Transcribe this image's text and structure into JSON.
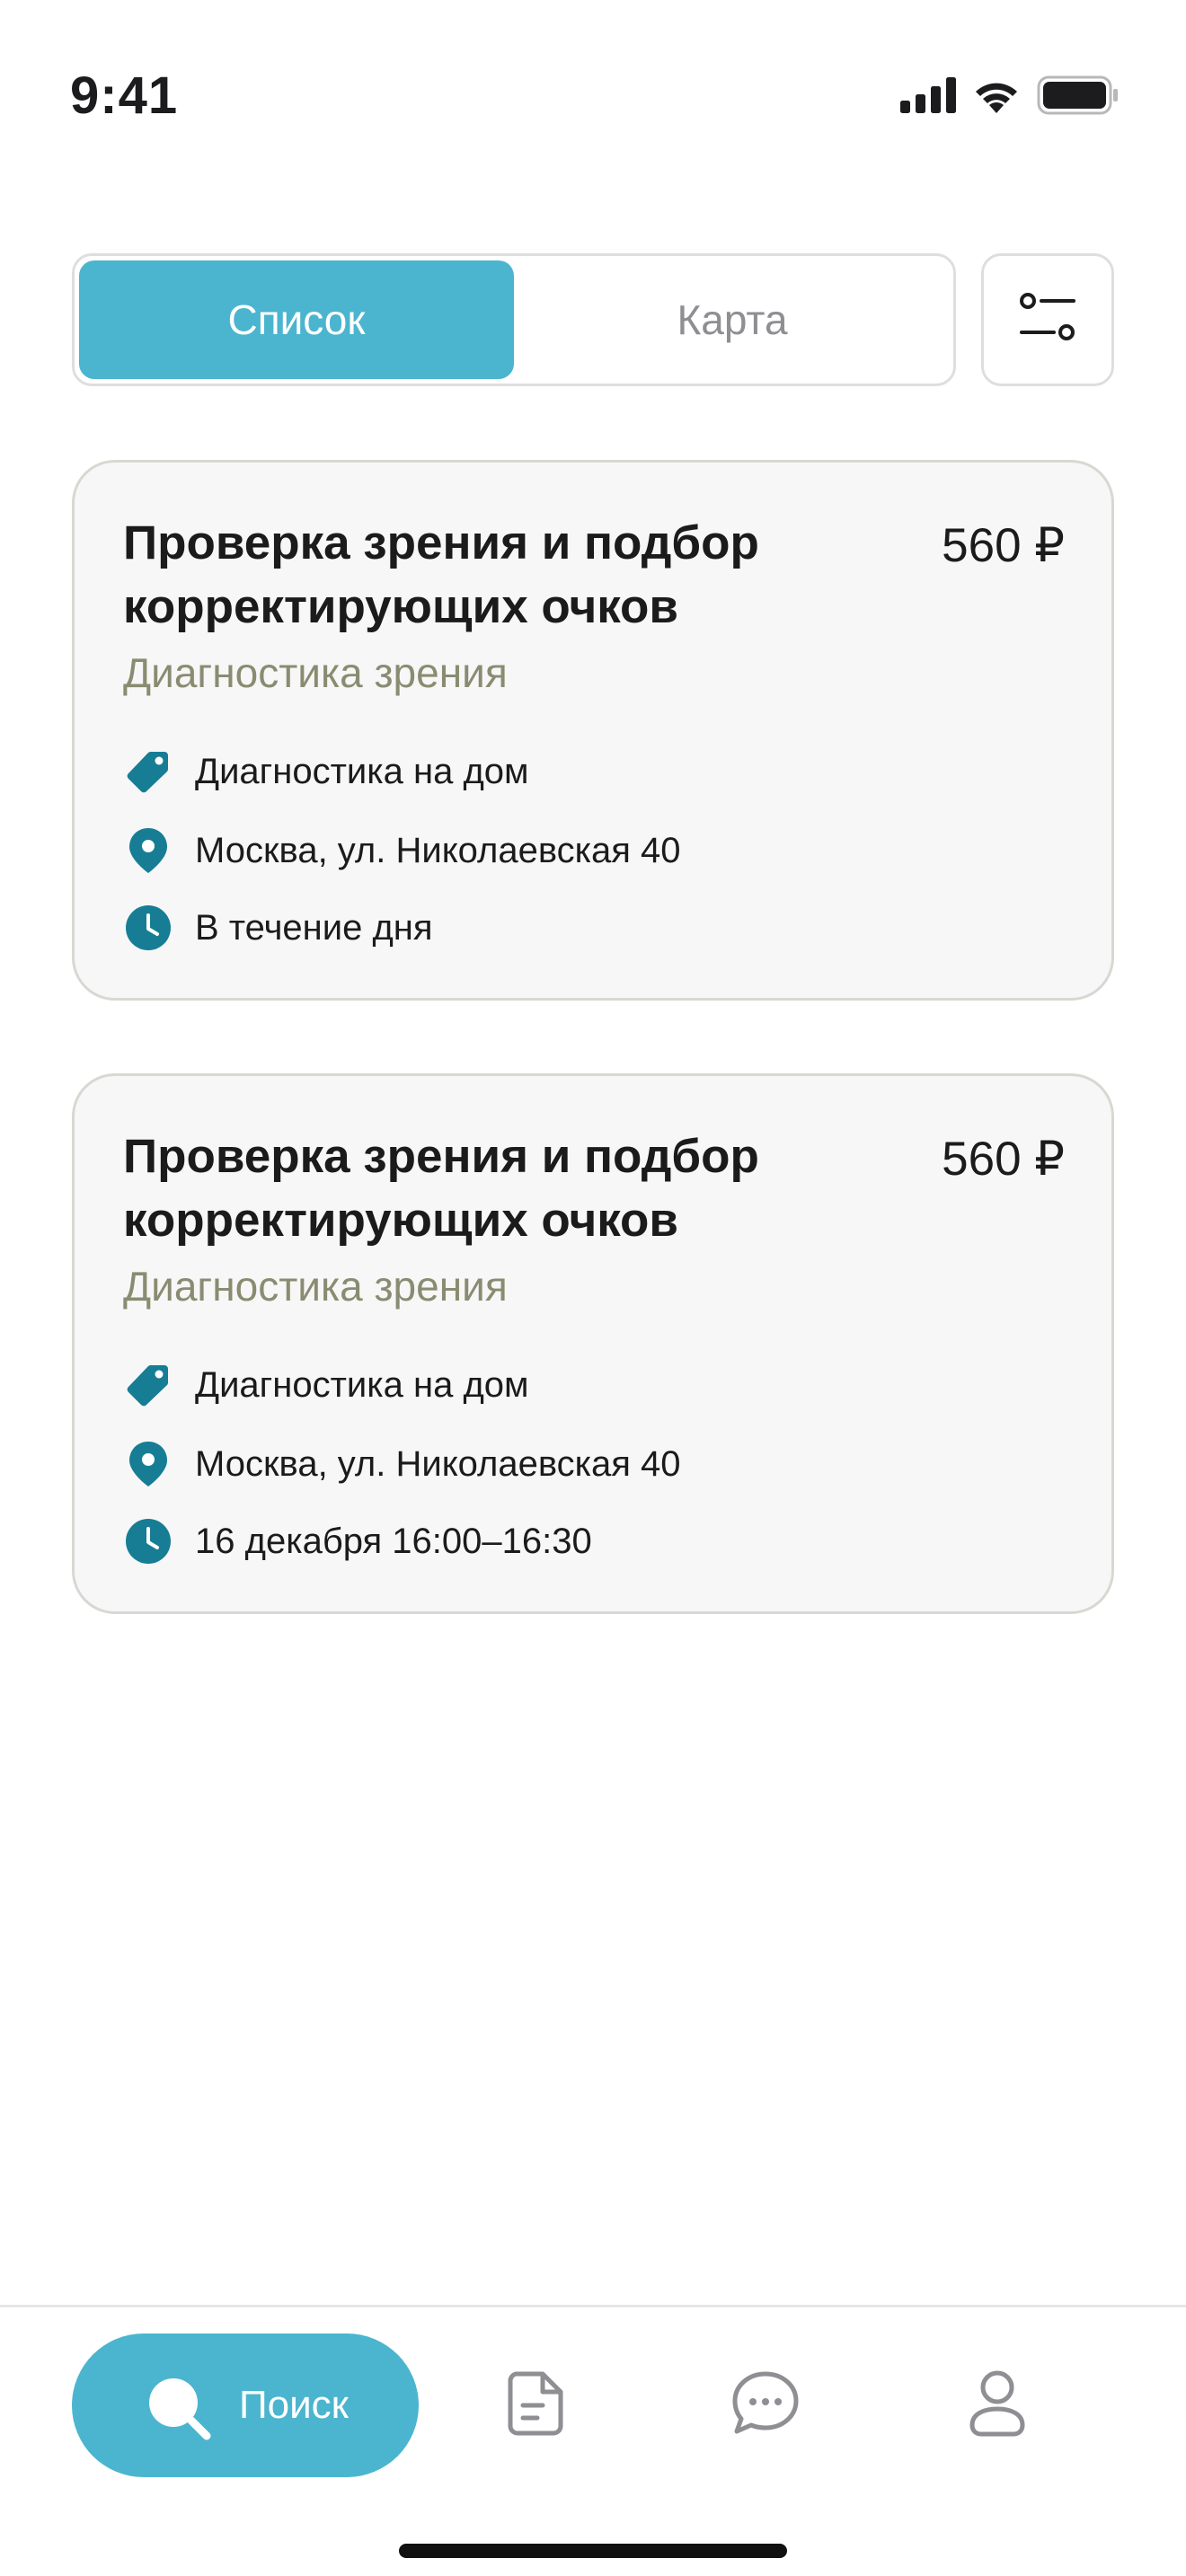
{
  "status_bar": {
    "time": "9:41"
  },
  "view_toggle": {
    "list_label": "Список",
    "map_label": "Карта",
    "active": "list",
    "filter_icon": "filter-sliders-icon"
  },
  "colors": {
    "accent": "#4bb5cf",
    "icon_teal": "#167d94",
    "category_text": "#8a8c71",
    "card_bg": "#f7f7f8"
  },
  "cards": [
    {
      "title": "Проверка зрения и подбор корректирующих очков",
      "price": "560 ₽",
      "category": "Диагностика зрения",
      "service_type": "Диагностика на дом",
      "address": "Москва, ул. Николаевская 40",
      "time": "В течение дня"
    },
    {
      "title": "Проверка зрения и подбор корректирующих очков",
      "price": "560 ₽",
      "category": "Диагностика зрения",
      "service_type": "Диагностика на дом",
      "address": "Москва, ул. Николаевская 40",
      "time": "16 декабря 16:00–16:30"
    }
  ],
  "tab_bar": {
    "search_label": "Поиск",
    "tabs": [
      "search-icon",
      "document-icon",
      "chat-icon",
      "profile-icon"
    ]
  }
}
